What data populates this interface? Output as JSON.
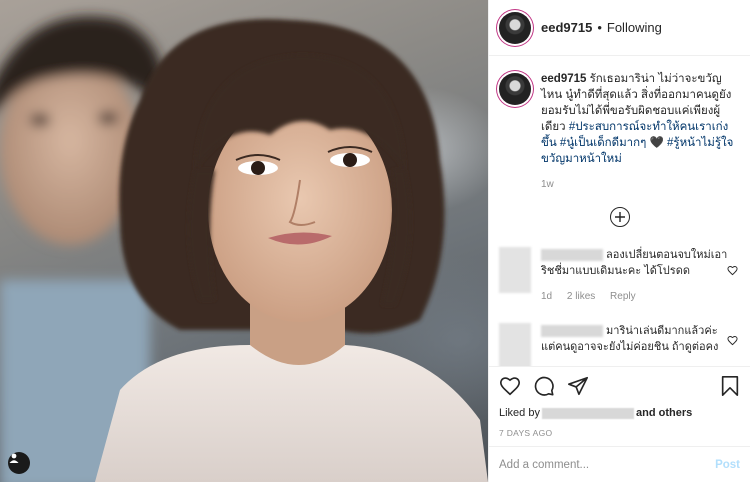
{
  "post": {
    "username": "eed9715",
    "follow_status": "Following",
    "separator": "•"
  },
  "caption": {
    "username": "eed9715",
    "text": "รักเธอมาริน่า ไม่ว่าจะขวัญไหน นู๋ทำดีที่สุดแล้ว สิ่งที่ออกมาคนดูยังยอมรับไม่ได้พี่ขอรับผิดชอบแค่เพียงผู้เดียว",
    "hashtags": "#ประสบการณ์จะทำให้คนเราเก่งขึ้น #นู๋เป็นเด็กดีมากๆ",
    "heart": "🖤",
    "hashtags2": "#รู้หน้าไม่รู้ใจขวัญมาหน้าใหม่",
    "time": "1w"
  },
  "comments": [
    {
      "text": " ลองเปลี่ยนตอนจบใหม่เอาริชชี่มาแบบเดิมนะคะ ได้โปรดด",
      "time": "1d",
      "likes": "2 likes",
      "reply": "Reply"
    },
    {
      "text": " มาริน่าเล่นดีมากแล้วค่ะ แต่คนดูอาจจะยังไม่ค่อยชิน ถ้าดูต่อคง"
    }
  ],
  "likes": {
    "prefix": "Liked by",
    "suffix": "and others"
  },
  "posted_ago": "7 DAYS AGO",
  "comment_box": {
    "placeholder": "Add a comment...",
    "post_label": "Post"
  },
  "icons": [
    "heart-icon",
    "comment-icon",
    "share-icon",
    "bookmark-icon",
    "plus-circle-icon",
    "user-icon"
  ],
  "colors": {
    "text": "#262626",
    "secondary": "#8e8e8e",
    "hashtag": "#003569",
    "post_disabled": "#b2dffc",
    "story_ring": "#c13584"
  }
}
